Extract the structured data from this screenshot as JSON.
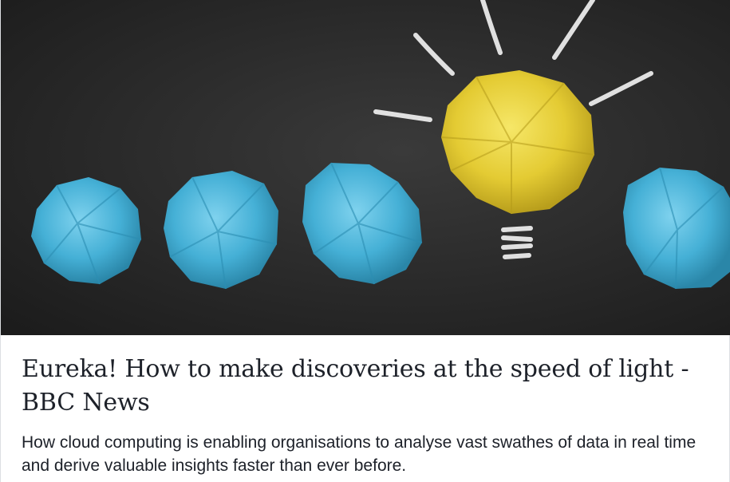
{
  "link_preview": {
    "image_alt": "Crumpled blue paper balls beside a crumpled yellow paper light bulb with chalk-drawn rays and base on a blackboard",
    "headline": "Eureka! How to make discoveries at the speed of light - BBC News",
    "description": "How cloud computing is enabling organisations to analyse vast swathes of data in real time and derive valuable insights faster than ever before."
  },
  "colors": {
    "background": "#262626",
    "blue_paper": "#4ab5da",
    "yellow_paper": "#e8d03a",
    "chalk": "#f2f2f2",
    "text": "#1d2129"
  }
}
